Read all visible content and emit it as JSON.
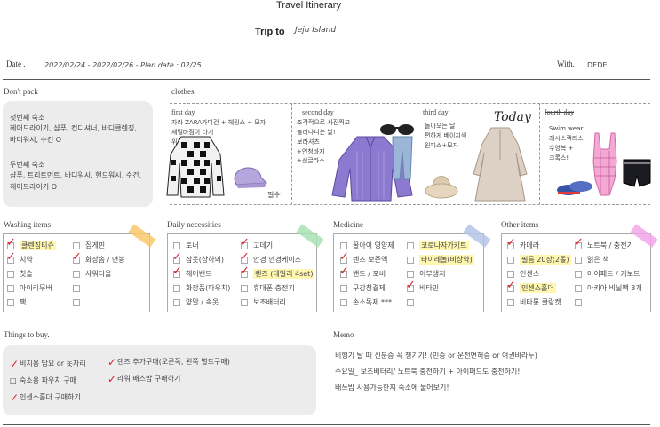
{
  "header": {
    "title": "Travel Itinerary",
    "trip_label": "Trip to",
    "trip_value": "Jeju Island",
    "date_label": "Date .",
    "date_value": "2022/02/24 - 2022/02/26 - Plan date : 02/25",
    "with_label": "With.",
    "with_value": "DEDE"
  },
  "dont_pack": {
    "title": "Don't pack",
    "paragraph1": [
      "첫번째 숙소",
      "헤어드라이기, 샴푸, 컨디셔너, 바디클렌징,",
      "바디워시, 수건 O"
    ],
    "paragraph2": [
      "두번째 숙소",
      "샴푸, 트리트먼트, 바디워시, 핸드워시, 수건,",
      "헤어드라이기 O"
    ]
  },
  "clothes": {
    "title": "clothes",
    "days": [
      {
        "label": "first day",
        "note": "자라 ZARA가디건 + 헤링스 + 모자\n새털바짐이 타기\n위해 편안차림!",
        "extra": "필수!"
      },
      {
        "label": "second day",
        "note": "조각적으로 사진찍고\n놀러다니는 날!\n보라셔츠\n+연청바지\n+선글라스",
        "extra": ""
      },
      {
        "label": "third day",
        "note": "돌아오는 날\n편하게 베이지색\n원피스+모자",
        "extra": "Today"
      },
      {
        "label": "fourth day",
        "note": "Swim wear\n래시스랙리스\n수영복 +\n크록스!",
        "extra": ""
      }
    ]
  },
  "washing": {
    "title": "Washing items",
    "left": [
      {
        "label": "클렌징티슈",
        "checked": true,
        "hl": true
      },
      {
        "label": "치약",
        "checked": true,
        "hl": false
      },
      {
        "label": "칫솔",
        "checked": false,
        "hl": false
      },
      {
        "label": "아이리무버",
        "checked": false,
        "hl": false
      },
      {
        "label": "팩",
        "checked": false,
        "hl": false
      }
    ],
    "right": [
      {
        "label": "집게핀",
        "checked": false,
        "hl": false
      },
      {
        "label": "화장솜 / 면봉",
        "checked": true,
        "hl": false
      },
      {
        "label": "샤워타올",
        "checked": false,
        "hl": false
      },
      {
        "label": "",
        "checked": false,
        "hl": false
      },
      {
        "label": "",
        "checked": false,
        "hl": false
      }
    ]
  },
  "daily": {
    "title": "Daily necessities",
    "left": [
      {
        "label": "토너",
        "checked": false,
        "hl": false
      },
      {
        "label": "잠옷(상하의)",
        "checked": true,
        "hl": false
      },
      {
        "label": "헤어밴드",
        "checked": true,
        "hl": false
      },
      {
        "label": "화장품(파우치)",
        "checked": false,
        "hl": false
      },
      {
        "label": "양말 / 속옷",
        "checked": false,
        "hl": false
      }
    ],
    "right": [
      {
        "label": "고데기",
        "checked": true,
        "hl": false
      },
      {
        "label": "안경 안경케이스",
        "checked": true,
        "hl": false
      },
      {
        "label": "렌즈 (데일리 4set)",
        "checked": true,
        "hl": true
      },
      {
        "label": "휴대폰 충전기",
        "checked": false,
        "hl": false
      },
      {
        "label": "보조배터리",
        "checked": false,
        "hl": false
      }
    ]
  },
  "medicine": {
    "title": "Medicine",
    "left": [
      {
        "label": "꿀아이 영양제",
        "checked": false,
        "hl": false
      },
      {
        "label": "렌즈 보존액",
        "checked": true,
        "hl": false
      },
      {
        "label": "밴드 / 포비",
        "checked": true,
        "hl": false
      },
      {
        "label": "구강청결제",
        "checked": false,
        "hl": false
      },
      {
        "label": "손소독제 ***",
        "checked": false,
        "hl": false
      }
    ],
    "right": [
      {
        "label": "코로나자가키트",
        "checked": false,
        "hl": true
      },
      {
        "label": "타이레놀(비상약)",
        "checked": false,
        "hl": true
      },
      {
        "label": "이부생저",
        "checked": false,
        "hl": false
      },
      {
        "label": "비타민",
        "checked": true,
        "hl": false
      },
      {
        "label": "",
        "checked": false,
        "hl": false
      }
    ]
  },
  "other": {
    "title": "Other items",
    "left": [
      {
        "label": "카메라",
        "checked": true,
        "hl": false
      },
      {
        "label": "필름 20장(2롤)",
        "checked": false,
        "hl": true
      },
      {
        "label": "인센스",
        "checked": false,
        "hl": false
      },
      {
        "label": "인센스홀더",
        "checked": true,
        "hl": true
      },
      {
        "label": "비타롱 클랑켓",
        "checked": false,
        "hl": false
      }
    ],
    "right": [
      {
        "label": "노트북 / 충전기",
        "checked": true,
        "hl": false
      },
      {
        "label": "읽은 책",
        "checked": false,
        "hl": false
      },
      {
        "label": "아이패드 / 키보드",
        "checked": false,
        "hl": false
      },
      {
        "label": "아키아 비닐팩 3개",
        "checked": false,
        "hl": false
      },
      {
        "label": "",
        "checked": false,
        "hl": false
      }
    ]
  },
  "things": {
    "title": "Things to buy.",
    "left": [
      {
        "label": "비치용 담요 or 돗자리",
        "checked": true
      },
      {
        "label": "숙소용 파우치 구매",
        "checked": false
      },
      {
        "label": "인센스홀더 구매하기",
        "checked": true
      }
    ],
    "right": [
      {
        "label": "렌즈 추가구매(오른쪽, 왼쪽 별도구매)",
        "checked": true
      },
      {
        "label": "라워 배스밤 구매하기",
        "checked": true
      }
    ]
  },
  "memo": {
    "title": "Memo",
    "lines": [
      "비행기 탈 때 신분증 꼭 챙기기! (민증 or 운전면허증 or 여권바라두)",
      "수요일_ 보조배터리/ 노트북 충전하기 + 아이패드도 충전하기!",
      "배쓰밤 사용가능한지 숙소에 물어보기!"
    ]
  },
  "colors": {
    "check": "#d61f2c",
    "highlight": "#fff6b0",
    "panel": "#ececec",
    "tape_orange": "#f9c96b",
    "tape_green": "#a8e2b4",
    "tape_blue": "#b4c4e6",
    "tape_pink": "#f2a6e6"
  }
}
